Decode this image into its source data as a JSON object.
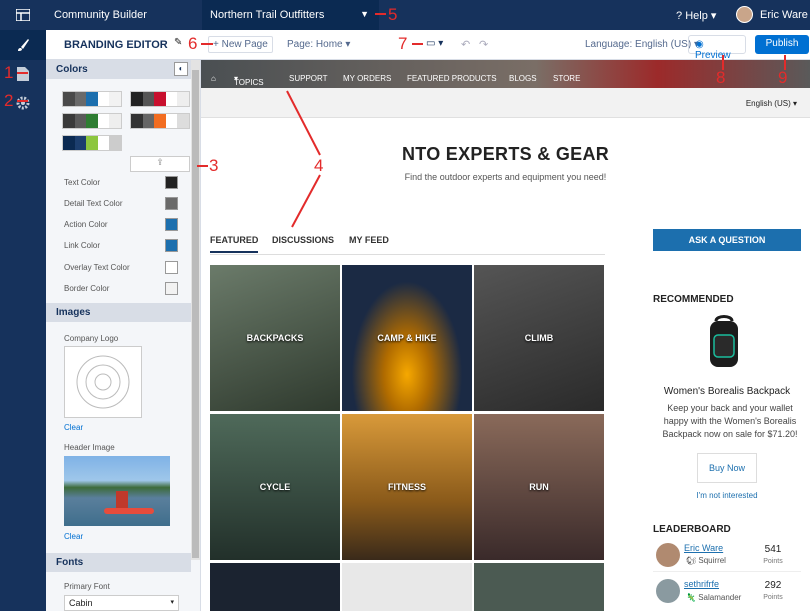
{
  "app": {
    "name": "Community Builder",
    "site": "Northern Trail Outfitters",
    "help": "Help",
    "user": "Eric Ware"
  },
  "toolbar": {
    "title": "BRANDING EDITOR",
    "new_page": "New Page",
    "page": "Page: Home",
    "language": "Language: English (US)",
    "preview": "Preview",
    "publish": "Publish"
  },
  "panel": {
    "colors_title": "Colors",
    "color_rows": [
      "Text Color",
      "Detail Text Color",
      "Action Color",
      "Link Color",
      "Overlay Text Color",
      "Border Color"
    ],
    "color_values": [
      "#222222",
      "#6a6a6a",
      "#1c6fae",
      "#1c6fae",
      "#ffffff",
      "#f2f2f2"
    ],
    "images_title": "Images",
    "company_logo": "Company Logo",
    "clear": "Clear",
    "header_image": "Header Image",
    "fonts_title": "Fonts",
    "primary_font": "Primary Font",
    "font_value": "Cabin"
  },
  "site": {
    "nav": [
      "TOPICS",
      "SUPPORT",
      "MY ORDERS",
      "FEATURED PRODUCTS",
      "BLOGS",
      "STORE"
    ],
    "language": "English (US)",
    "title": "NTO EXPERTS & GEAR",
    "subtitle": "Find the outdoor experts and equipment you need!",
    "tabs": [
      "FEATURED",
      "DISCUSSIONS",
      "MY FEED"
    ],
    "tiles": [
      "BACKPACKS",
      "CAMP & HIKE",
      "CLIMB",
      "CYCLE",
      "FITNESS",
      "RUN"
    ],
    "ask": "ASK A QUESTION",
    "recommended": "RECOMMENDED",
    "product_name": "Women's Borealis Backpack",
    "product_desc": "Keep your back and your wallet happy with the Women's Borealis Backpack now on sale for $71.20!",
    "buy_now": "Buy Now",
    "not_interested": "I'm not interested",
    "leaderboard": "LEADERBOARD",
    "leaders": [
      {
        "name": "Eric Ware",
        "rank": "Squirrel",
        "points": "541",
        "label": "Points"
      },
      {
        "name": "sethrifrfe",
        "rank": "Salamander",
        "points": "292",
        "label": "Points"
      }
    ]
  },
  "callouts": [
    "1",
    "2",
    "3",
    "4",
    "5",
    "6",
    "7",
    "8",
    "9"
  ]
}
